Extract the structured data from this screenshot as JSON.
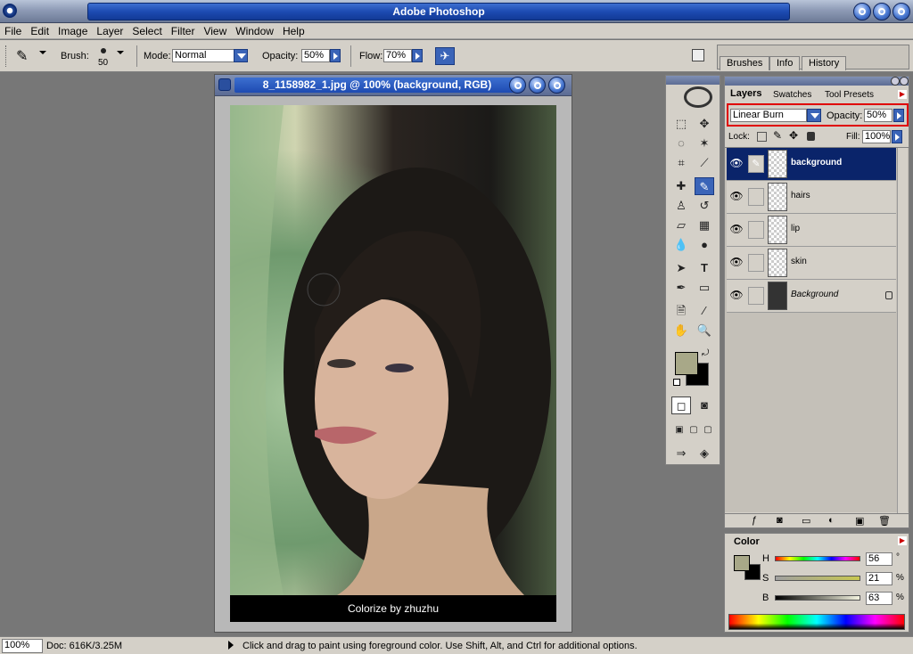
{
  "app": {
    "title": "Adobe Photoshop"
  },
  "menu": [
    "File",
    "Edit",
    "Image",
    "Layer",
    "Select",
    "Filter",
    "View",
    "Window",
    "Help"
  ],
  "options": {
    "brush_label": "Brush:",
    "brush_size": "50",
    "mode_label": "Mode:",
    "mode_value": "Normal",
    "opacity_label": "Opacity:",
    "opacity_value": "50%",
    "flow_label": "Flow:",
    "flow_value": "70%"
  },
  "palette_well_tabs": [
    "Brushes",
    "Info",
    "History"
  ],
  "document": {
    "title": "8_1158982_1.jpg @ 100% (background, RGB)",
    "caption": "Colorize by zhuzhu"
  },
  "layers_panel": {
    "tabs": [
      "Layers",
      "Swatches",
      "Tool Presets"
    ],
    "blend_mode": "Linear Burn",
    "opacity_label": "Opacity:",
    "opacity_value": "50%",
    "lock_label": "Lock:",
    "fill_label": "Fill:",
    "fill_value": "100%",
    "layers": [
      {
        "name": "background",
        "selected": true
      },
      {
        "name": "hairs",
        "selected": false
      },
      {
        "name": "lip",
        "selected": false
      },
      {
        "name": "skin",
        "selected": false
      },
      {
        "name": "Background",
        "selected": false,
        "locked": true
      }
    ]
  },
  "color_panel": {
    "tab": "Color",
    "h_label": "H",
    "h_value": "56",
    "h_unit": "°",
    "s_label": "S",
    "s_value": "21",
    "s_unit": "%",
    "b_label": "B",
    "b_value": "63",
    "b_unit": "%",
    "foreground_color": "#a8a888",
    "background_color": "#000000"
  },
  "status": {
    "zoom": "100%",
    "doc": "Doc: 616K/3.25M",
    "hint": "Click and drag to paint using foreground color.  Use Shift, Alt, and Ctrl for additional options."
  }
}
